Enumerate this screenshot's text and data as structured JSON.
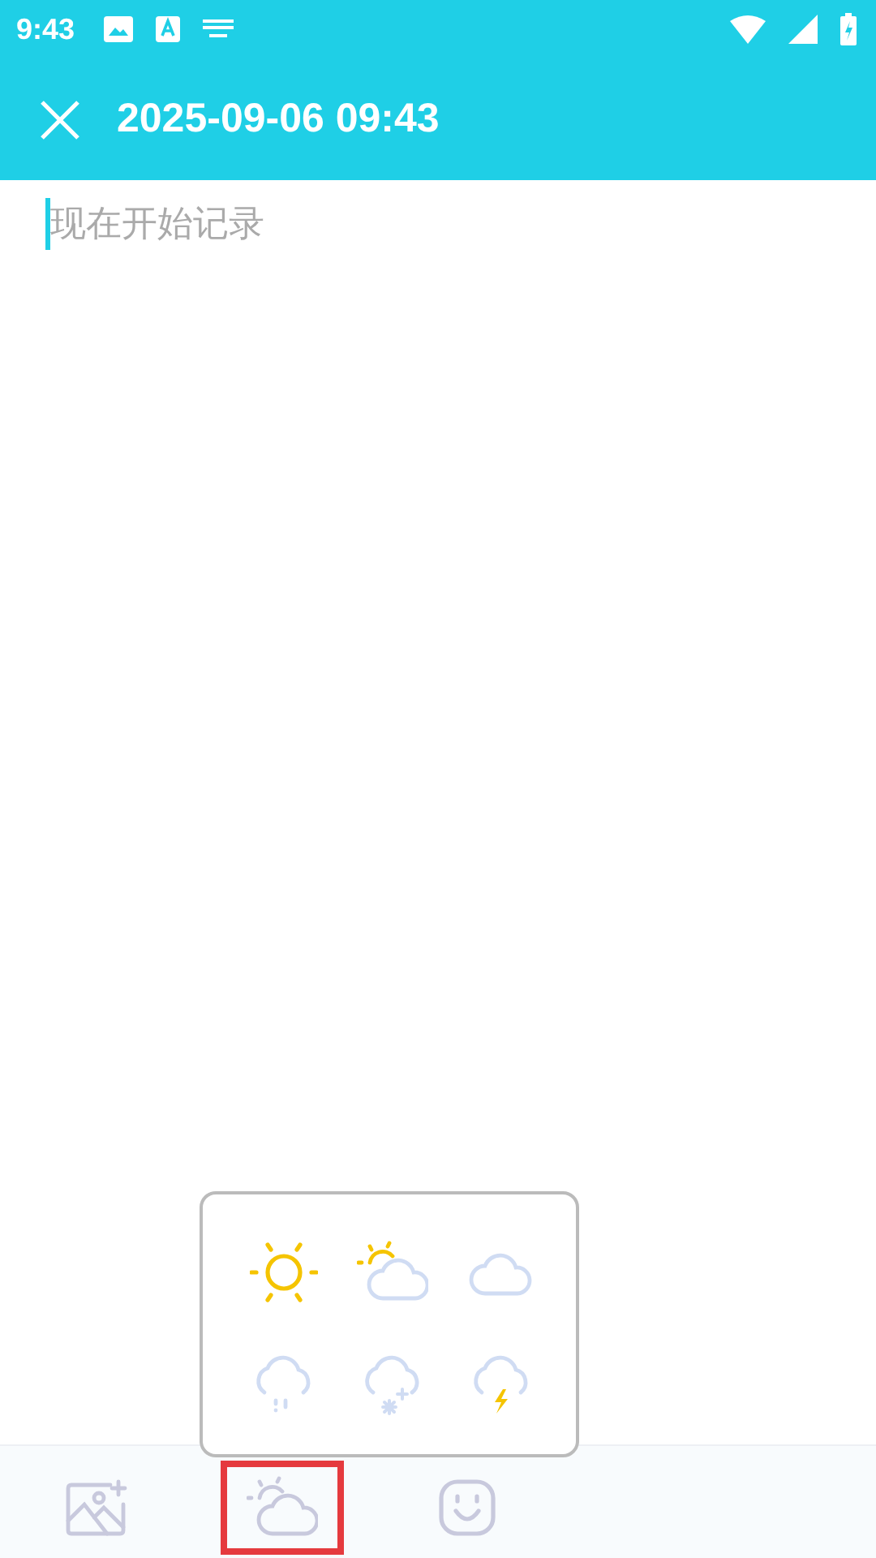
{
  "status_bar": {
    "time": "9:43"
  },
  "header": {
    "title": "2025-09-06 09:43"
  },
  "editor": {
    "placeholder": "现在开始记录"
  },
  "weather_picker": {
    "options": [
      {
        "kind": "sunny"
      },
      {
        "kind": "partly_cloudy"
      },
      {
        "kind": "cloudy"
      },
      {
        "kind": "rain"
      },
      {
        "kind": "snow"
      },
      {
        "kind": "thunder"
      }
    ]
  },
  "toolbar": {
    "items": [
      {
        "kind": "photo",
        "selected": false
      },
      {
        "kind": "weather",
        "selected": true
      },
      {
        "kind": "mood",
        "selected": false
      }
    ]
  }
}
